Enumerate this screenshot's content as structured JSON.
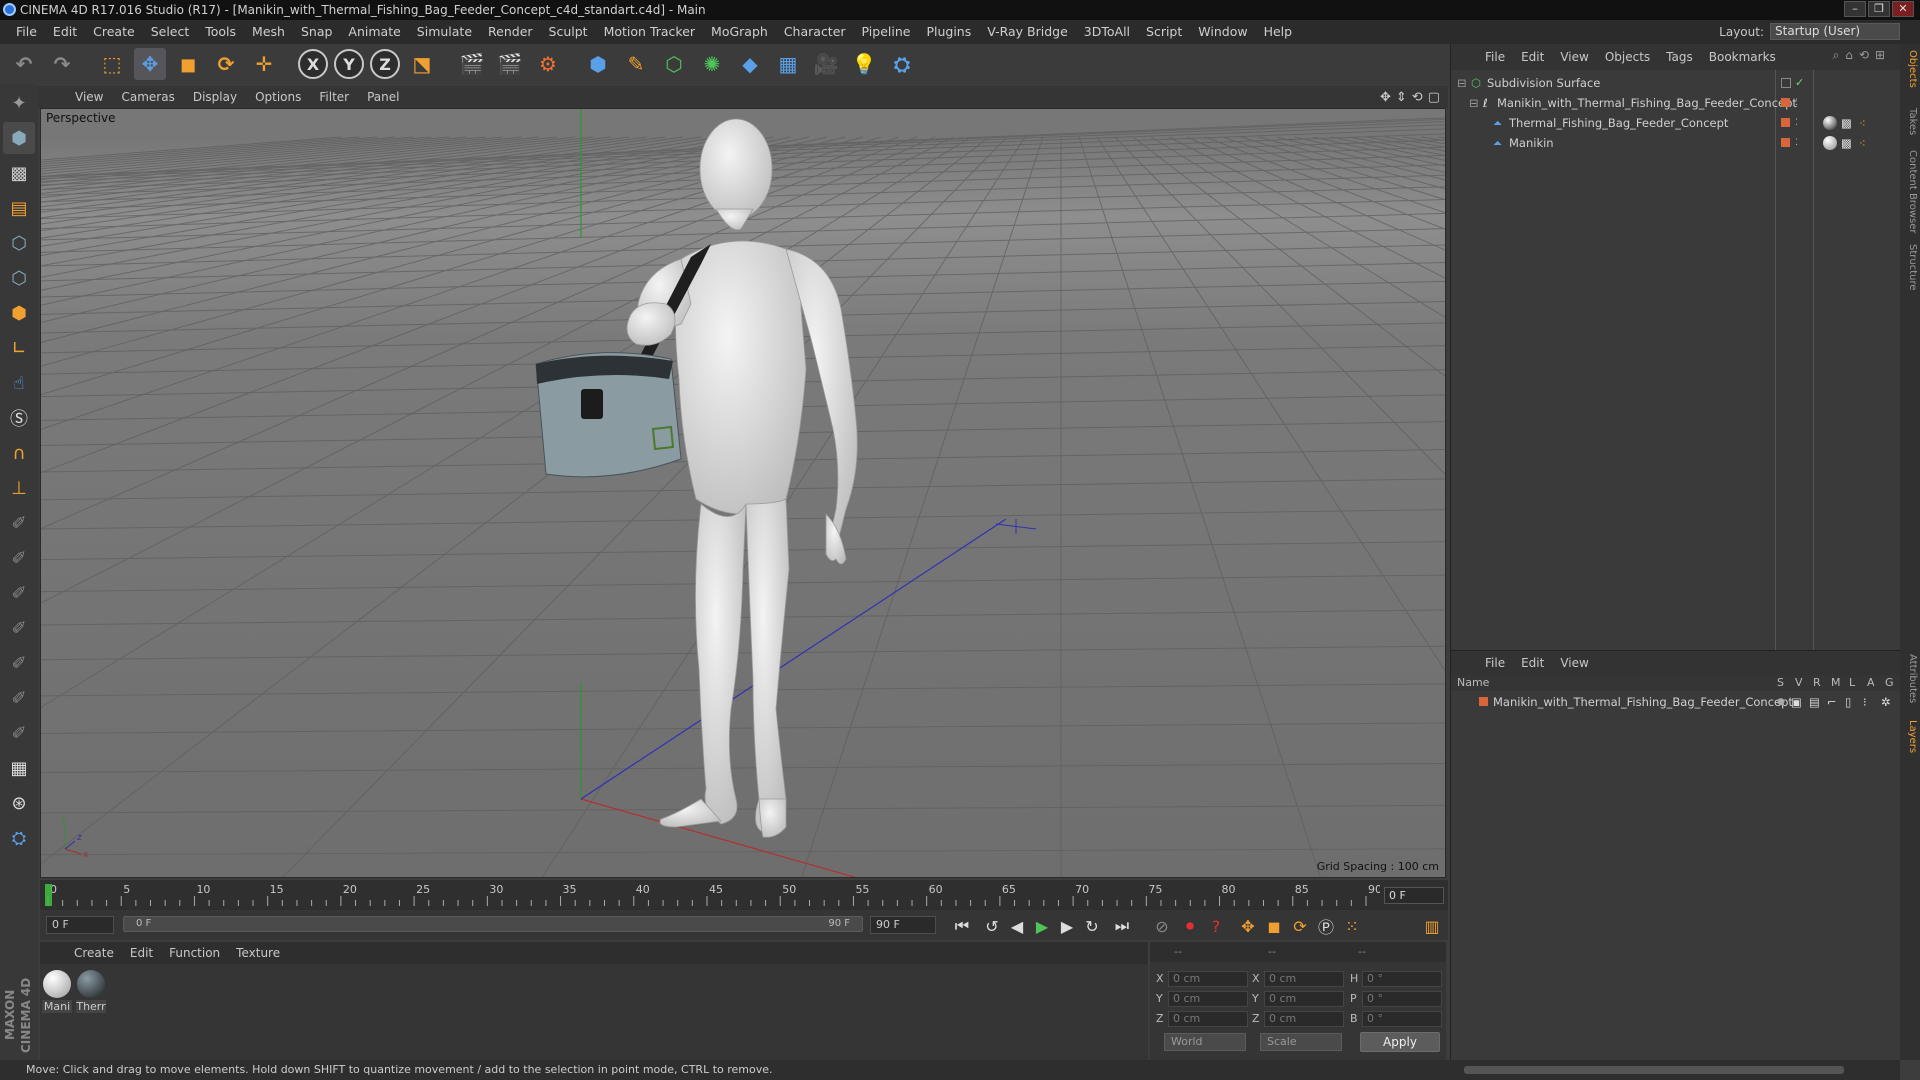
{
  "window": {
    "title": "CINEMA 4D R17.016 Studio (R17) - [Manikin_with_Thermal_Fishing_Bag_Feeder_Concept_c4d_standart.c4d] - Main",
    "controls": [
      "–",
      "❐",
      "✕"
    ]
  },
  "menubar": [
    "File",
    "Edit",
    "Create",
    "Select",
    "Tools",
    "Mesh",
    "Snap",
    "Animate",
    "Simulate",
    "Render",
    "Sculpt",
    "Motion Tracker",
    "MoGraph",
    "Character",
    "Pipeline",
    "Plugins",
    "V-Ray Bridge",
    "3DToAll",
    "Script",
    "Window",
    "Help"
  ],
  "layout": {
    "label": "Layout:",
    "value": "Startup (User)"
  },
  "viewport": {
    "menu": [
      "View",
      "Cameras",
      "Display",
      "Options",
      "Filter",
      "Panel"
    ],
    "camera_label": "Perspective",
    "grid_spacing": "Grid Spacing : 100 cm",
    "axis_labels": [
      "y",
      "x",
      "z"
    ]
  },
  "timeline": {
    "ticks": [
      "0",
      "5",
      "10",
      "15",
      "20",
      "25",
      "30",
      "35",
      "40",
      "45",
      "50",
      "55",
      "60",
      "65",
      "70",
      "75",
      "80",
      "85",
      "90"
    ],
    "current_frame": "0 F"
  },
  "transport": {
    "start_field": "0 F",
    "range_start": "0 F",
    "range_end": "90 F",
    "end_field": "90 F"
  },
  "materials": {
    "menu": [
      "Create",
      "Edit",
      "Function",
      "Texture"
    ],
    "items": [
      {
        "label": "Mani",
        "color": "#d8d8d8"
      },
      {
        "label": "Therr",
        "color": "#4a4f52"
      }
    ]
  },
  "coords": {
    "headers": [
      "--",
      "--",
      "--"
    ],
    "rows": [
      {
        "axis": "X",
        "pos": "0 cm",
        "axis2": "X",
        "size": "0 cm",
        "rot_axis": "H",
        "rot": "0 °"
      },
      {
        "axis": "Y",
        "pos": "0 cm",
        "axis2": "Y",
        "size": "0 cm",
        "rot_axis": "P",
        "rot": "0 °"
      },
      {
        "axis": "Z",
        "pos": "0 cm",
        "axis2": "Z",
        "size": "0 cm",
        "rot_axis": "B",
        "rot": "0 °"
      }
    ],
    "space": "World",
    "mode": "Scale",
    "apply": "Apply"
  },
  "status": "Move: Click and drag to move elements. Hold down SHIFT to quantize movement / add to the selection in point mode, CTRL to remove.",
  "objects": {
    "menu": [
      "File",
      "Edit",
      "View",
      "Objects",
      "Tags",
      "Bookmarks"
    ],
    "tree": [
      {
        "name": "Subdivision Surface",
        "indent": 0
      },
      {
        "name": "Manikin_with_Thermal_Fishing_Bag_Feeder_Concept",
        "indent": 1
      },
      {
        "name": "Thermal_Fishing_Bag_Feeder_Concept",
        "indent": 2
      },
      {
        "name": "Manikin",
        "indent": 2
      }
    ]
  },
  "layers": {
    "menu": [
      "File",
      "Edit",
      "View"
    ],
    "columns": [
      "Name",
      "S",
      "V",
      "R",
      "M",
      "L",
      "A",
      "G"
    ],
    "rows": [
      "Manikin_with_Thermal_Fishing_Bag_Feeder_Concept"
    ]
  },
  "side_tabs": [
    "Objects",
    "Takes",
    "Content Browser",
    "Structure",
    "Attributes",
    "Layers"
  ],
  "maxon_logo": "MAXON CINEMA 4D",
  "colors": {
    "accent": "#f0a030",
    "layer": "#d9663a",
    "ok": "#6fdc6f"
  }
}
